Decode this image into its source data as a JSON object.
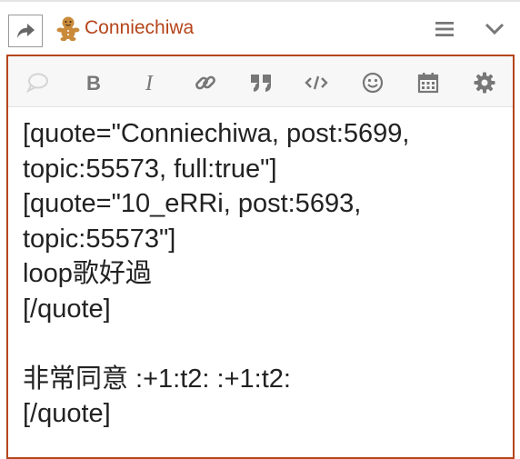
{
  "header": {
    "username": "Conniechiwa"
  },
  "icons": {
    "reply": "share-forward-icon",
    "avatar": "gingerbread-avatar",
    "menu": "hamburger-menu-icon",
    "collapse": "chevron-down-icon"
  },
  "toolbar": {
    "buttons": [
      "speech-bubble",
      "bold",
      "italic",
      "link",
      "blockquote",
      "preformatted-code",
      "emoji",
      "date",
      "options"
    ]
  },
  "colors": {
    "brand": "#b5451b",
    "icon": "#777777",
    "text": "#222222"
  },
  "editor": {
    "text": "[quote=\"Conniechiwa, post:5699,\ntopic:55573, full:true\"]\n[quote=\"10_eRRi, post:5693,\ntopic:55573\"]\nloop歌好過\n[/quote]\n\n非常同意 :+1:t2: :+1:t2:\n[/quote]"
  }
}
